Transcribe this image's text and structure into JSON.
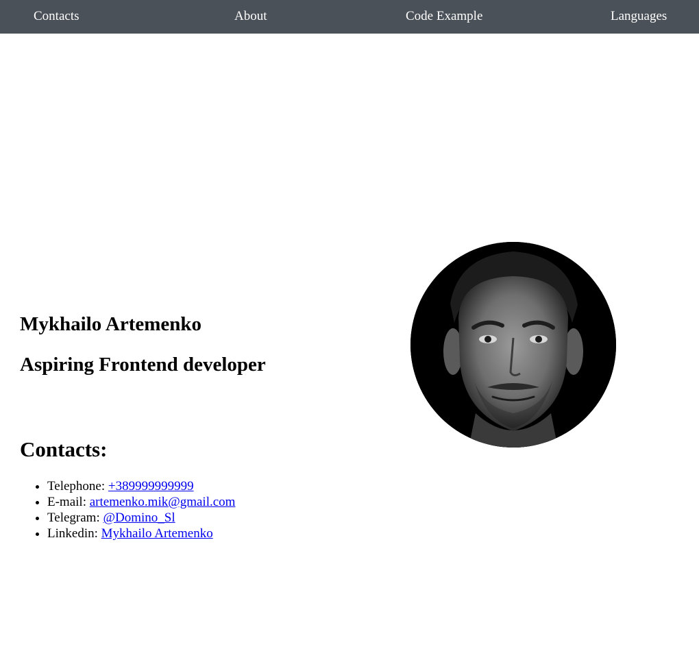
{
  "nav": {
    "items": [
      {
        "label": "Contacts"
      },
      {
        "label": "About"
      },
      {
        "label": "Code Example"
      },
      {
        "label": "Languages"
      }
    ],
    "background": "#4b5159",
    "text_color": "#ffffff"
  },
  "hero": {
    "name": "Mykhailo Artemenko",
    "role": "Aspiring Frontend developer",
    "photo_icon": "portrait-photo"
  },
  "contacts": {
    "heading": "Contacts:",
    "items": [
      {
        "label": "Telephone: ",
        "link": "+389999999999"
      },
      {
        "label": "E-mail: ",
        "link": "artemenko.mik@gmail.com"
      },
      {
        "label": "Telegram: ",
        "link": "@Domino_Sl"
      },
      {
        "label": "Linkedin: ",
        "link": "Mykhailo Artemenko"
      }
    ],
    "link_color": "#0000ee"
  }
}
